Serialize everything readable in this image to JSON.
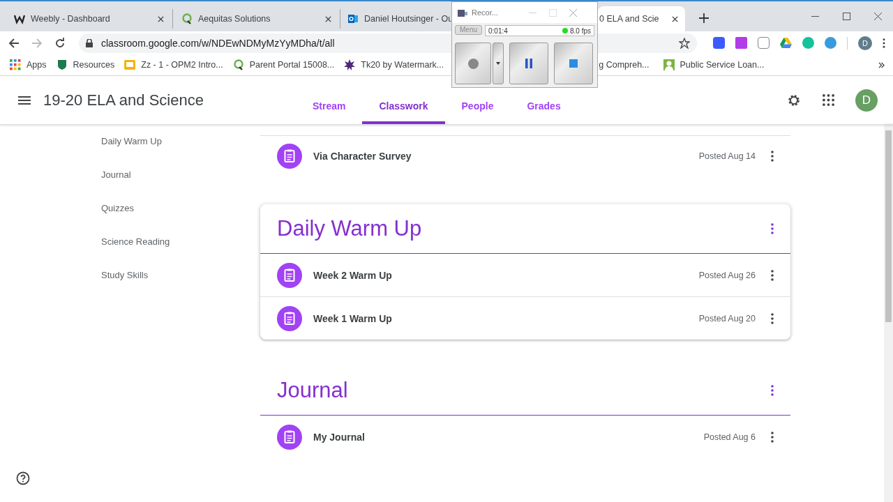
{
  "browser": {
    "tabs": [
      {
        "title": "Weebly - Dashboard",
        "selected": false
      },
      {
        "title": "Aequitas Solutions",
        "selected": false
      },
      {
        "title": "Daniel Houtsinger - Ou",
        "selected": false
      },
      {
        "title": "0 ELA and Scie",
        "selected": true
      }
    ],
    "address": "classroom.google.com/w/NDEwNDMyMzYyMDha/t/all",
    "bookmarks": [
      "Apps",
      "Resources",
      "Zz - 1 - OPM2 Intro...",
      "Parent Portal 15008...",
      "Tk20 by Watermark...",
      "g Compreh...",
      "Public Service Loan..."
    ],
    "profile_initial": "D"
  },
  "recorder": {
    "title": "Recor...",
    "menu": "Menu",
    "time": "0:01:4",
    "fps": "8.0 fps"
  },
  "app": {
    "course_title": "19-20 ELA and Science",
    "nav": [
      {
        "label": "Stream",
        "selected": false
      },
      {
        "label": "Classwork",
        "selected": true
      },
      {
        "label": "People",
        "selected": false
      },
      {
        "label": "Grades",
        "selected": false
      }
    ],
    "avatar": "D",
    "sidebar": [
      "Daily Warm Up",
      "Journal",
      "Quizzes",
      "Science Reading",
      "Study Skills"
    ],
    "sections": [
      {
        "kind": "plain",
        "items": [
          {
            "title": "Via Character Survey",
            "posted": "Posted Aug 14"
          }
        ]
      },
      {
        "kind": "card",
        "title": "Daily Warm Up",
        "items": [
          {
            "title": "Week 2 Warm Up",
            "posted": "Posted Aug 26"
          },
          {
            "title": "Week 1 Warm Up",
            "posted": "Posted Aug 20"
          }
        ]
      },
      {
        "kind": "topic",
        "title": "Journal",
        "items": [
          {
            "title": "My Journal",
            "posted": "Posted Aug 6"
          }
        ]
      }
    ]
  }
}
